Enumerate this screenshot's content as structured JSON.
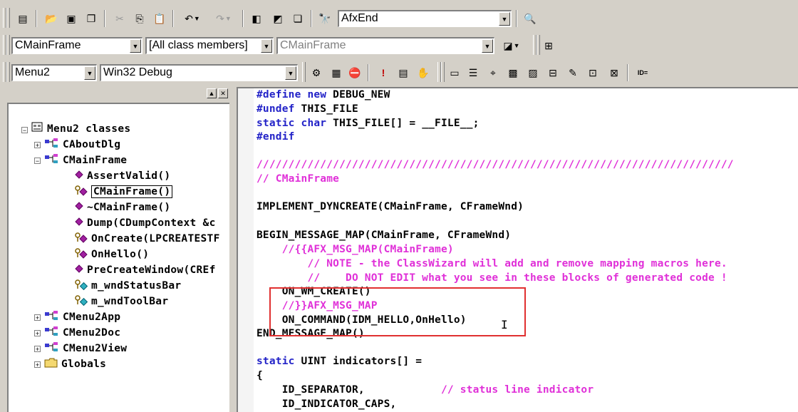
{
  "toolbar1": {
    "find_combo_value": "AfxEnd"
  },
  "toolbar2": {
    "class_combo_value": "CMainFrame",
    "filter_combo_value": "[All class members]",
    "member_combo_value": "CMainFrame"
  },
  "toolbar3": {
    "project_combo_value": "Menu2",
    "config_combo_value": "Win32 Debug",
    "id_label": "ID="
  },
  "tree": {
    "root": "Menu2 classes",
    "items": [
      {
        "label": "CAboutDlg"
      },
      {
        "label": "CMainFrame"
      },
      {
        "label": "AssertValid()"
      },
      {
        "label": "CMainFrame()"
      },
      {
        "label": "~CMainFrame()"
      },
      {
        "label": "Dump(CDumpContext &c"
      },
      {
        "label": "OnCreate(LPCREATESTF"
      },
      {
        "label": "OnHello()"
      },
      {
        "label": "PreCreateWindow(CREf"
      },
      {
        "label": "m_wndStatusBar"
      },
      {
        "label": "m_wndToolBar"
      },
      {
        "label": "CMenu2App"
      },
      {
        "label": "CMenu2Doc"
      },
      {
        "label": "CMenu2View"
      },
      {
        "label": "Globals"
      }
    ]
  },
  "editor": {
    "lines": [
      {
        "kw": "#define new ",
        "rest": "DEBUG_NEW"
      },
      {
        "kw": "#undef ",
        "rest": "THIS_FILE"
      },
      {
        "kw": "static char ",
        "rest": "THIS_FILE[] = __FILE__;"
      },
      {
        "kw": "#endif",
        "rest": ""
      },
      {
        "cm": "///////////////////////////////////////////////////////////////////////////"
      },
      {
        "cm": "// CMainFrame"
      },
      {
        "text": "IMPLEMENT_DYNCREATE(CMainFrame, CFrameWnd)"
      },
      {
        "text": "BEGIN_MESSAGE_MAP(CMainFrame, CFrameWnd)"
      },
      {
        "cm": "    //{{AFX_MSG_MAP(CMainFrame)"
      },
      {
        "cm": "        // NOTE - the ClassWizard will add and remove mapping macros here."
      },
      {
        "cm": "        //    DO NOT EDIT what you see in these blocks of generated code !"
      },
      {
        "text": "    ON_WM_CREATE()"
      },
      {
        "cm": "    //}}AFX_MSG_MAP"
      },
      {
        "text": "    ON_COMMAND(IDM_HELLO,OnHello)"
      },
      {
        "text": "END_MESSAGE_MAP()"
      },
      {
        "kw": "static ",
        "rest": "UINT indicators[] ="
      },
      {
        "text": "{"
      },
      {
        "text": "    ID_SEPARATOR,",
        "cm2": "            // status line indicator"
      },
      {
        "text": "    ID_INDICATOR_CAPS,"
      }
    ]
  },
  "colors": {
    "keyword": "#2323c8",
    "comment": "#e030d8",
    "highlight_box": "#e03030",
    "face": "#d4d0c8"
  }
}
